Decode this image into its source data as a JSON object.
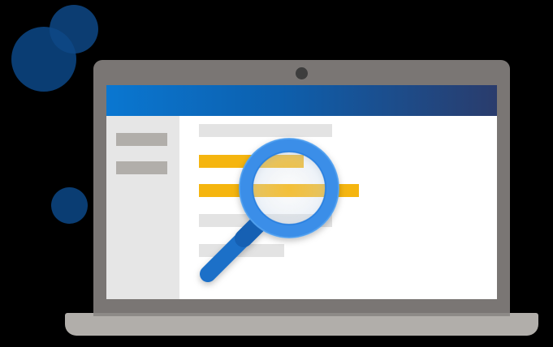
{
  "illustration": {
    "subject": "laptop-with-magnifying-glass",
    "colors": {
      "background": "#000000",
      "bubble": "#0a3d73",
      "lid": "#7a7674",
      "base": "#b1aeaa",
      "titlebar_start": "#0a77d1",
      "titlebar_end": "#2a3c6c",
      "sidebar": "#e6e6e6",
      "placeholder_gray": "#e3e3e3",
      "highlight_yellow": "#f5b50f",
      "magnifier_ring": "#3a8ee8",
      "magnifier_handle": "#1b6fc8"
    },
    "icons": [
      "camera-icon",
      "magnifying-glass-icon"
    ],
    "sidebar_items": 2,
    "content_lines": [
      "gray",
      "yellow",
      "yellow",
      "gray",
      "gray"
    ]
  }
}
